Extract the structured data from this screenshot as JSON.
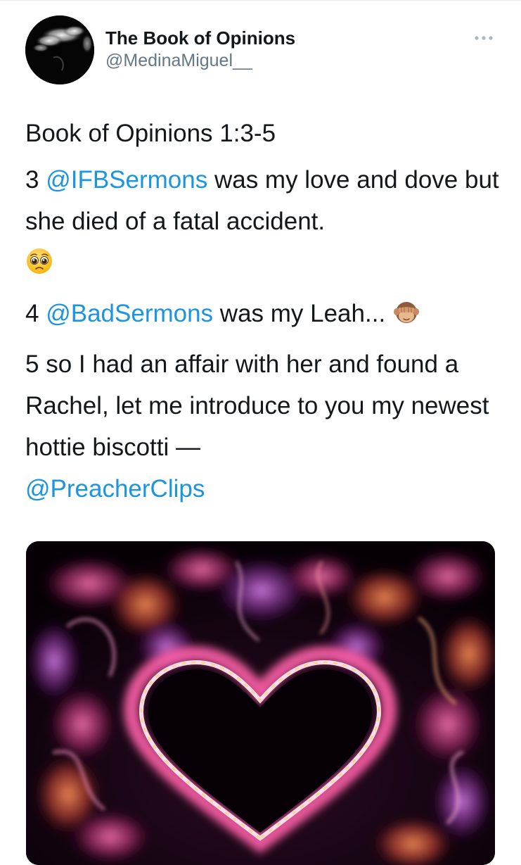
{
  "tweet": {
    "author": {
      "display_name": "The Book of Opinions",
      "handle": "@MedinaMiguel__"
    },
    "more_icon": "ellipsis-icon",
    "lines": {
      "title": "Book of Opinions 1:3-5",
      "verse3": {
        "num": "3",
        "mention": "@IFBSermons",
        "text": " was my love and dove but she died of a fatal accident.",
        "emoji": "pleading-face-emoji"
      },
      "verse4": {
        "num": "4",
        "mention": "@BadSermons",
        "text": " was my Leah... ",
        "emoji": "see-no-evil-monkey-emoji"
      },
      "verse5": {
        "text": "5 so I had an affair with her and found a Rachel, let me introduce to you my newest hottie biscotti —",
        "mention": "@PreacherClips"
      }
    },
    "media": {
      "kind": "gif",
      "description_icon": "glowing-heart-image"
    },
    "colors": {
      "link": "#1b95e0",
      "secondary": "#657786",
      "text": "#14171a"
    }
  }
}
